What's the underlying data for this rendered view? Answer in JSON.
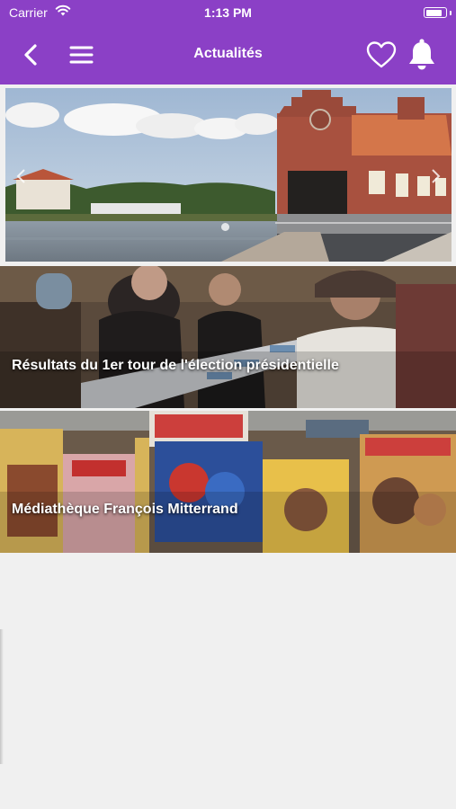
{
  "status_bar": {
    "carrier": "Carrier",
    "time": "1:13 PM",
    "battery_level": 0.85
  },
  "nav": {
    "title": "Actualités",
    "back_icon": "chevron-left-icon",
    "menu_icon": "hamburger-menu-icon",
    "favorite_icon": "heart-icon",
    "notification_icon": "bell-icon"
  },
  "carousel": {
    "slide_count": 1,
    "active_slide": 1
  },
  "articles": [
    {
      "title": "Résultats du 1er tour de l'élection présidentielle"
    },
    {
      "title": "Médiathèque François Mitterrand"
    }
  ],
  "colors": {
    "header": "#8b40c6",
    "background": "#f0f0f0"
  }
}
